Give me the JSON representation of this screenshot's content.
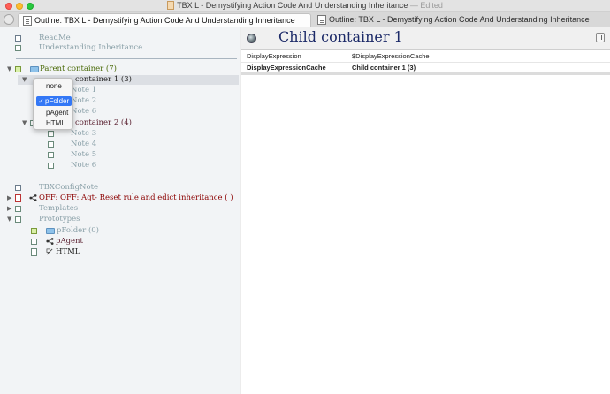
{
  "window": {
    "title": "TBX L - Demystifying Action Code And Understanding Inheritance",
    "title_suffix": " — Edited"
  },
  "tabs": [
    {
      "label": "Outline: TBX L - Demystifying Action Code And Understanding Inheritance"
    },
    {
      "label": "Outline: TBX L - Demystifying Action Code And Understanding Inheritance"
    }
  ],
  "outline": {
    "readme": "ReadMe",
    "understanding": "Understanding Inheritance",
    "parent": "Parent container (7)",
    "child1": "Child container 1 (3)",
    "child1_visible": "container 1 (3)",
    "note1": "Note 1",
    "note2": "Note 2",
    "note6a": "Note 6",
    "child2": "container 2 (4)",
    "note3": "Note 3",
    "note4": "Note 4",
    "note5": "Note 5",
    "note6b": "Note 6",
    "config": "TBXConfigNote",
    "agent": "OFF: OFF: Agt- Reset rule and edict inheritance ( )",
    "templates": "Templates",
    "prototypes": "Prototypes",
    "pfolder": "pFolder (0)",
    "pagent": "pAgent",
    "html": "HTML"
  },
  "popup": {
    "items": [
      "none",
      "pFolder",
      "pAgent",
      "HTML"
    ],
    "selected": "pFolder",
    "check_mark": "✓"
  },
  "note": {
    "title": "Child container 1",
    "attributes": [
      {
        "name": "DisplayExpression",
        "value": "$DisplayExpressionCache"
      },
      {
        "name": "DisplayExpressionCache",
        "value": "Child container 1 (3)"
      }
    ]
  },
  "icons": {
    "disclosure_open": "triangle-down-icon",
    "disclosure_closed": "triangle-right-icon",
    "note": "note-icon",
    "folder": "folder-icon",
    "agent": "share-agent-icon"
  }
}
